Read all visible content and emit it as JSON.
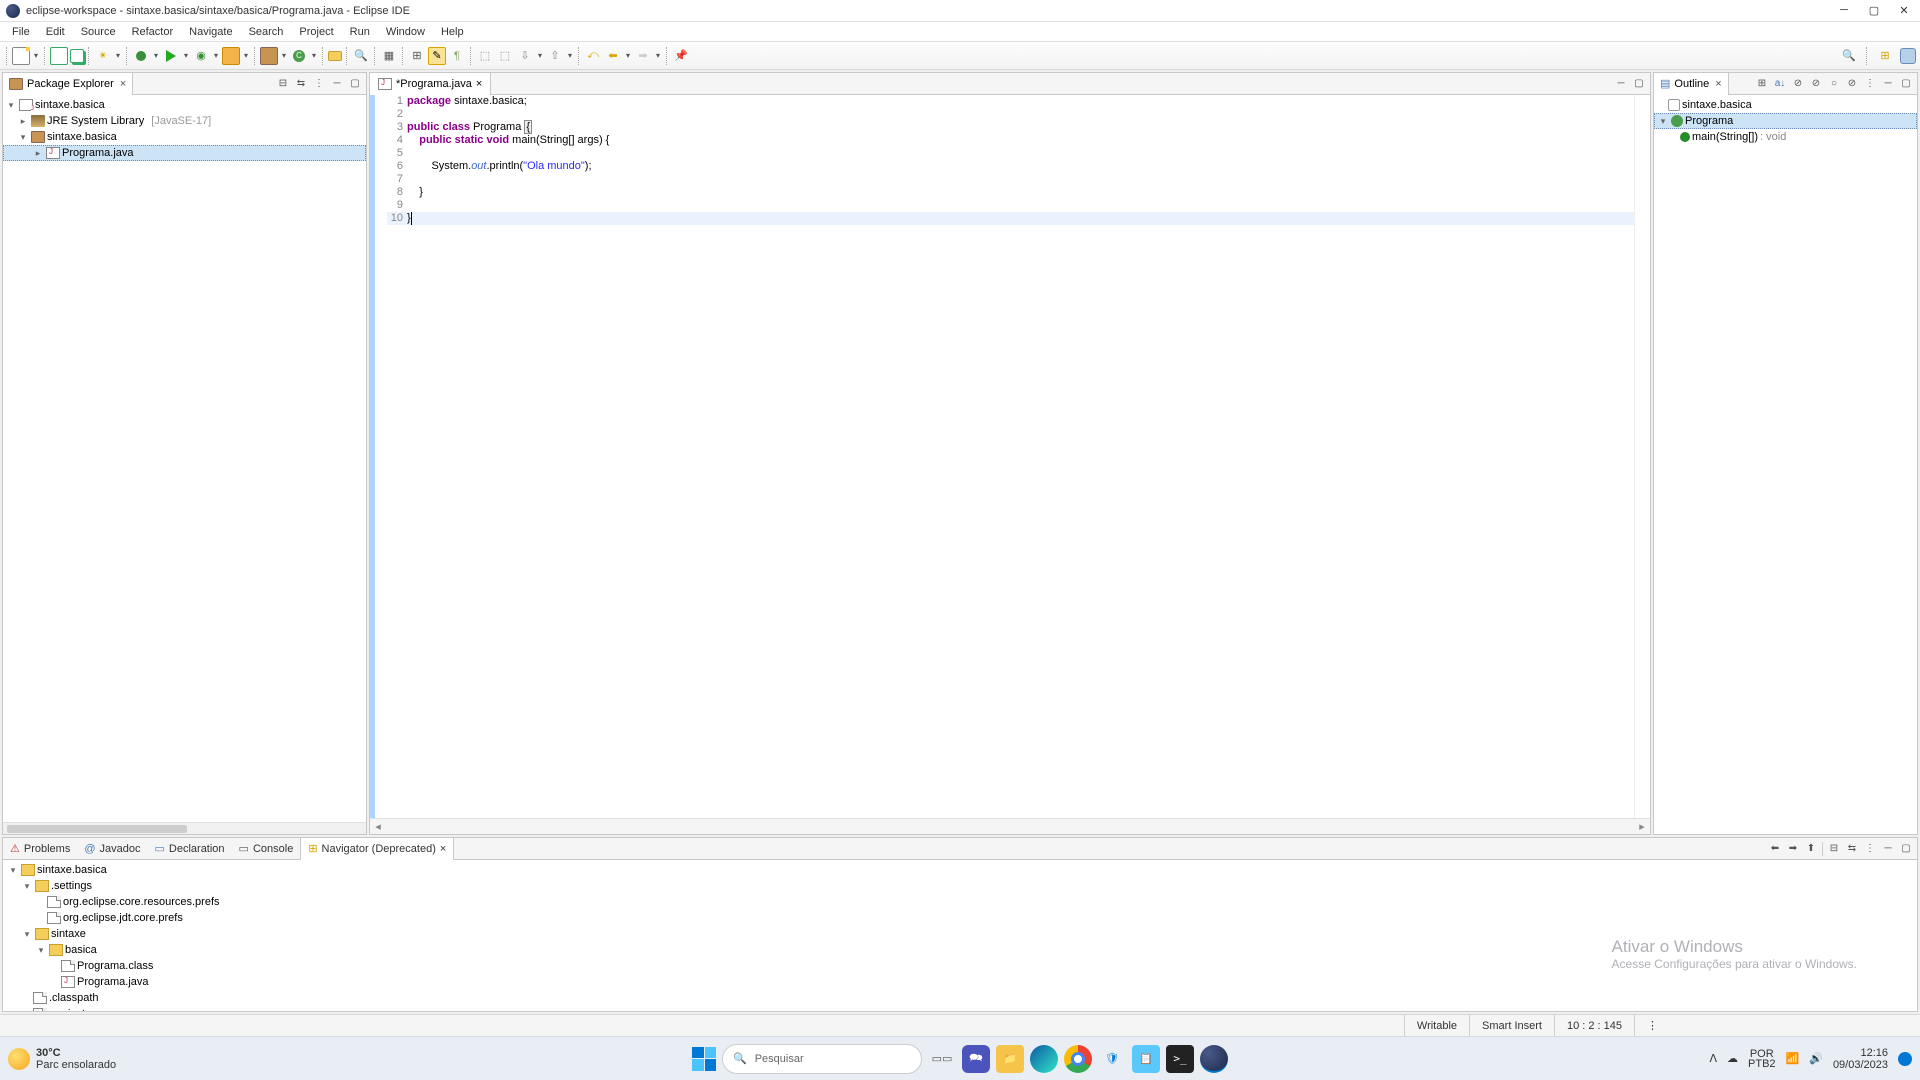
{
  "window": {
    "title": "eclipse-workspace - sintaxe.basica/sintaxe/basica/Programa.java - Eclipse IDE"
  },
  "menu": {
    "items": [
      "File",
      "Edit",
      "Source",
      "Refactor",
      "Navigate",
      "Search",
      "Project",
      "Run",
      "Window",
      "Help"
    ]
  },
  "package_explorer": {
    "title": "Package Explorer",
    "project": "sintaxe.basica",
    "jre": "JRE System Library",
    "jre_version": "[JavaSE-17]",
    "pkg": "sintaxe.basica",
    "file": "Programa.java"
  },
  "editor": {
    "tab": "*Programa.java",
    "lines": {
      "l1_pre": "package",
      "l1_post": " sintaxe.basica;",
      "l3a": "public",
      "l3b": " class",
      "l3c": " Programa ",
      "l3d": "{",
      "l4a": "    public",
      "l4b": " static",
      "l4c": " void",
      "l4d": " main(String[] args) {",
      "l6a": "        System",
      "l6b": ".",
      "l6c": "out",
      "l6d": ".println(",
      "l6e": "\"Ola mundo\"",
      "l6f": ");",
      "l8": "    }",
      "l10": "}"
    },
    "linenos": [
      "1",
      "2",
      "3",
      "4",
      "5",
      "6",
      "7",
      "8",
      "9",
      "10"
    ]
  },
  "outline": {
    "title": "Outline",
    "pkg": "sintaxe.basica",
    "class": "Programa",
    "method": "main(String[])",
    "ret": " : void"
  },
  "bottom": {
    "tabs": {
      "problems": "Problems",
      "javadoc": "Javadoc",
      "declaration": "Declaration",
      "console": "Console",
      "navigator": "Navigator (Deprecated)"
    },
    "tree": {
      "root": "sintaxe.basica",
      "settings": ".settings",
      "s1": "org.eclipse.core.resources.prefs",
      "s2": "org.eclipse.jdt.core.prefs",
      "sintaxe": "sintaxe",
      "basica": "basica",
      "f1": "Programa.class",
      "f2": "Programa.java",
      "classpath": ".classpath",
      "project": ".project"
    }
  },
  "status": {
    "writable": "Writable",
    "insert": "Smart Insert",
    "pos": "10 : 2 : 145"
  },
  "taskbar": {
    "temp": "30°C",
    "weather": "Parc ensolarado",
    "search": "Pesquisar",
    "lang1": "POR",
    "lang2": "PTB2",
    "time": "12:16",
    "date": "09/03/2023"
  },
  "activate": {
    "title": "Ativar o Windows",
    "sub": "Acesse Configurações para ativar o Windows."
  }
}
